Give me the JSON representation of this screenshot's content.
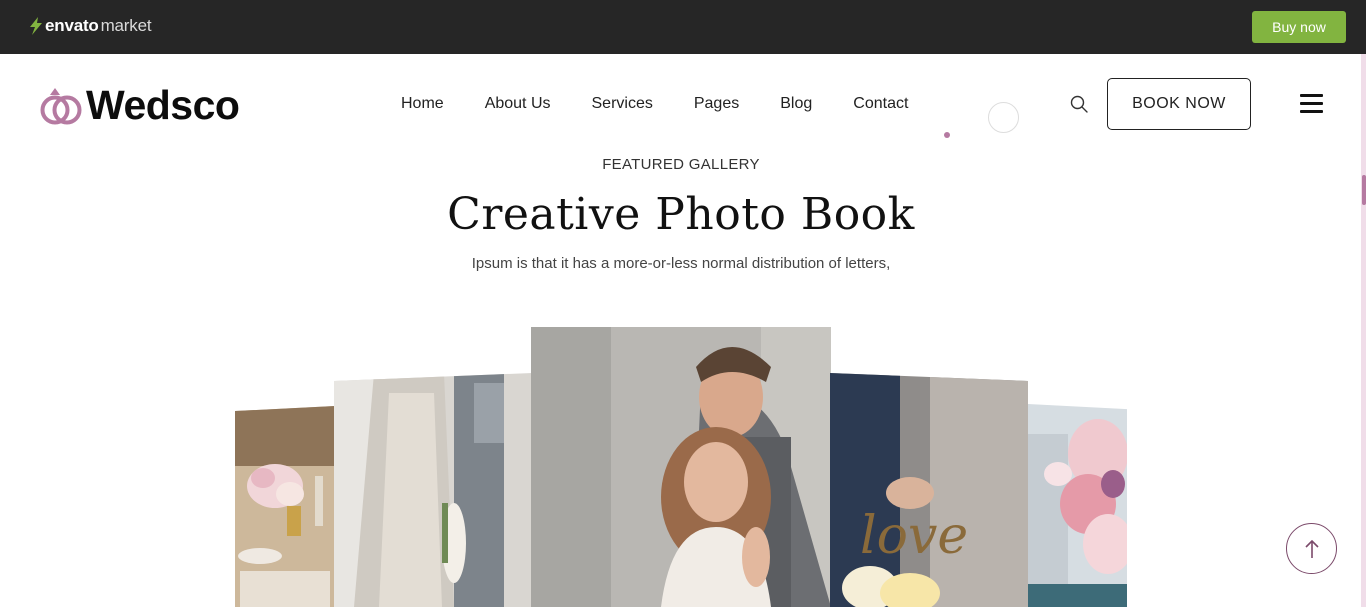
{
  "envato": {
    "brand": "envato",
    "market": "market",
    "buy_label": "Buy now",
    "accent": "#82b440"
  },
  "header": {
    "logo_text": "Wedsco",
    "nav": [
      "Home",
      "About Us",
      "Services",
      "Pages",
      "Blog",
      "Contact"
    ],
    "book_label": "BOOK NOW",
    "accent": "#b57aa1"
  },
  "gallery": {
    "eyebrow": "FEATURED GALLERY",
    "title": "Creative Photo Book",
    "subtitle": "Ipsum is that it has a more-or-less normal distribution of letters,",
    "photos": [
      "table-setting-photo",
      "bride-dress-photo",
      "couple-portrait-photo",
      "love-sign-photo",
      "flower-arch-photo"
    ]
  },
  "icons": {
    "search": "search-icon",
    "menu": "hamburger-menu-icon",
    "back_to_top": "arrow-up-icon"
  }
}
